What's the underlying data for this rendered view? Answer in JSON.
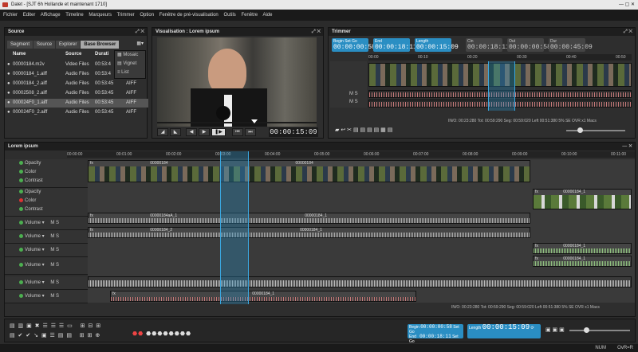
{
  "app": {
    "title": "Dalet - [SJT 6h Hollande et maintenant 1710]"
  },
  "menu": [
    "Fichier",
    "Editer",
    "Affichage",
    "Timeline",
    "Marqueurs",
    "Trimmer",
    "Option",
    "Fenêtre de pré-visualisation",
    "Outils",
    "Fenêtre",
    "Aide"
  ],
  "source": {
    "title": "Source",
    "tabs": [
      "Segment",
      "Source",
      "Explorer",
      "Base Browser"
    ],
    "columns": [
      "Name",
      "Source",
      "Durati"
    ],
    "view_menu": [
      "Mosaic",
      "Vignet",
      "List"
    ],
    "rows": [
      {
        "name": "00000184.m2v",
        "source": "Video Files",
        "dur": "00:53:4"
      },
      {
        "name": "00000184_1.aiff",
        "source": "Audio Files",
        "dur": "00:53:4"
      },
      {
        "name": "00000184_2.aiff",
        "source": "Audio Files",
        "dur": "00:53:45",
        "extra": "AIFF"
      },
      {
        "name": "00002508_2.aiff",
        "source": "Audio Files",
        "dur": "00:53:45",
        "extra": "AIFF"
      },
      {
        "name": "000024F0_1.aiff",
        "source": "Audio Files",
        "dur": "00:53:45",
        "extra": "AIFF"
      },
      {
        "name": "000024F0_2.aiff",
        "source": "Audio Files",
        "dur": "00:53:45",
        "extra": "AIFF"
      }
    ]
  },
  "viewer": {
    "title": "Visualisation : Lorem ipsum",
    "timecode": "00:00:15:09"
  },
  "trimmer": {
    "title": "Trimmer",
    "begin": {
      "label": "Begin",
      "sub": "Set Go",
      "value": "00:00:00:58"
    },
    "end": {
      "label": "End",
      "value": "00:00:18:11"
    },
    "length": {
      "label": "Length",
      "value": "00:00:15:09"
    },
    "cin": {
      "label": "Cin",
      "value": "00:00:18:11"
    },
    "cout": {
      "label": "Out",
      "value": "00:00:00:58"
    },
    "dur": {
      "label": "Dur",
      "value": "00:00:45:09"
    },
    "ruler": [
      "00:00",
      "00:10",
      "00:20",
      "00:30",
      "00:40",
      "00:50"
    ],
    "status": "IN/O: 00:23:280    Tot: 00:59:290    Seg: 00:59:020    Left 00:51:380    5%    SE    OVR    x1    Macs"
  },
  "timeline": {
    "title": "Lorem ipsum",
    "ruler": [
      "00:00:00",
      "00:01:00",
      "00:02:00",
      "00:03:00",
      "00:04:00",
      "00:05:00",
      "00:06:00",
      "00:07:00",
      "00:08:00",
      "00:09:00",
      "00:10:00",
      "00:11:00"
    ],
    "track_labels": {
      "opacity": "Opacity",
      "color": "Color",
      "contrast": "Contrast",
      "volume": "Volume",
      "fx": "fx"
    },
    "clip_names": {
      "v1": "00000184",
      "v1b": "00000184",
      "v2": "00000184_1",
      "a1": "00000184aA_1",
      "a1b": "00000184_1",
      "a2": "00000184_2",
      "a2b": "00000184_1",
      "a5": "00000184_1"
    },
    "status": "IN/O: 00:23:280    Tot: 00:59:290    Seg: 00:59:020    Left 00:51:380    5%    SE    OVR    x1    Macs"
  },
  "transport": {
    "begin": {
      "label": "Begin",
      "value": "00:00:00:58"
    },
    "end": {
      "label": "End",
      "value": "00:00:18:11"
    },
    "length": {
      "label": "Length",
      "value": "00:00:15:09"
    },
    "set": "Set",
    "go": "Go"
  },
  "statusbar": {
    "num": "NUM",
    "extra": "OvR=R"
  },
  "colors": {
    "accent": "#2a8ec3",
    "panel": "#2e2e2e",
    "background": "#1a1a1a"
  }
}
